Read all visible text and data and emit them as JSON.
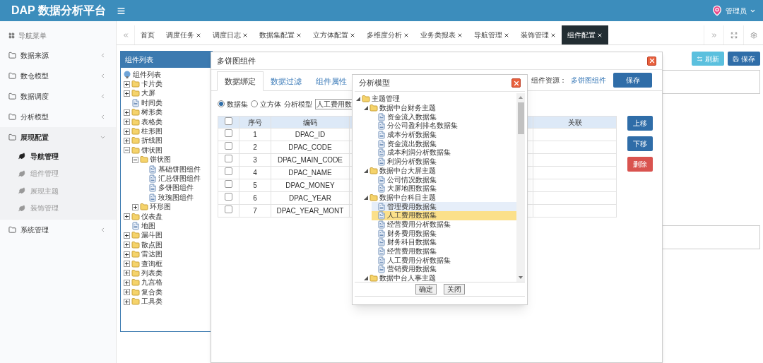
{
  "header": {
    "title": "DAP 数据分析平台",
    "user": "管理员"
  },
  "sidebar": {
    "title": "导航菜单",
    "items": [
      {
        "label": "数据来源",
        "expanded": false
      },
      {
        "label": "数仓模型",
        "expanded": false
      },
      {
        "label": "数据调度",
        "expanded": false
      },
      {
        "label": "分析模型",
        "expanded": false
      },
      {
        "label": "展现配置",
        "expanded": true,
        "children": [
          {
            "label": "导航管理",
            "selected": true
          },
          {
            "label": "组件管理",
            "selected": false
          },
          {
            "label": "展现主题",
            "selected": false
          },
          {
            "label": "装饰管理",
            "selected": false
          }
        ]
      },
      {
        "label": "系统管理",
        "expanded": false
      }
    ]
  },
  "tabs": [
    {
      "label": "首页",
      "closable": false,
      "selected": false
    },
    {
      "label": "调度任务",
      "closable": true,
      "selected": false
    },
    {
      "label": "调度日志",
      "closable": true,
      "selected": false
    },
    {
      "label": "数据集配置",
      "closable": true,
      "selected": false
    },
    {
      "label": "立方体配置",
      "closable": true,
      "selected": false
    },
    {
      "label": "多维度分析",
      "closable": true,
      "selected": false
    },
    {
      "label": "业务类报表",
      "closable": true,
      "selected": false
    },
    {
      "label": "导航管理",
      "closable": true,
      "selected": false
    },
    {
      "label": "装饰管理",
      "closable": true,
      "selected": false
    },
    {
      "label": "组件配置",
      "closable": true,
      "selected": true
    }
  ],
  "toolbar": [
    {
      "label": "刷新",
      "kind": "refresh"
    },
    {
      "label": "保存",
      "kind": "save"
    }
  ],
  "component_panel": {
    "title": "组件列表",
    "root": "组件列表",
    "tree": [
      {
        "label": "卡片类",
        "kind": "folder",
        "expanded": false
      },
      {
        "label": "大屏",
        "kind": "folder",
        "expanded": false
      },
      {
        "label": "时间类",
        "kind": "file"
      },
      {
        "label": "树形类",
        "kind": "folder",
        "expanded": false
      },
      {
        "label": "表格类",
        "kind": "folder",
        "expanded": false
      },
      {
        "label": "柱形图",
        "kind": "folder",
        "expanded": false
      },
      {
        "label": "折线图",
        "kind": "folder",
        "expanded": false
      },
      {
        "label": "饼状图",
        "kind": "folder",
        "expanded": true,
        "children": [
          {
            "label": "饼状图",
            "kind": "folder",
            "expanded": true,
            "children": [
              {
                "label": "基础饼图组件",
                "kind": "file"
              },
              {
                "label": "汇总饼图组件",
                "kind": "file"
              },
              {
                "label": "多饼图组件",
                "kind": "file"
              },
              {
                "label": "玫瑰图组件",
                "kind": "file"
              }
            ]
          },
          {
            "label": "环形图",
            "kind": "folder",
            "expanded": false
          }
        ]
      },
      {
        "label": "仪表盘",
        "kind": "folder",
        "expanded": false
      },
      {
        "label": "地图",
        "kind": "file"
      },
      {
        "label": "漏斗图",
        "kind": "folder",
        "expanded": false
      },
      {
        "label": "散点图",
        "kind": "folder",
        "expanded": false
      },
      {
        "label": "雷达图",
        "kind": "folder",
        "expanded": false
      },
      {
        "label": "查询框",
        "kind": "folder",
        "expanded": false
      },
      {
        "label": "列表类",
        "kind": "folder",
        "expanded": false
      },
      {
        "label": "九宫格",
        "kind": "folder",
        "expanded": false
      },
      {
        "label": "复合类",
        "kind": "folder",
        "expanded": false
      },
      {
        "label": "工具类",
        "kind": "folder",
        "expanded": false
      }
    ]
  },
  "dialog": {
    "title": "多饼图组件",
    "tabs": [
      {
        "label": "数据绑定",
        "selected": true
      },
      {
        "label": "数据过滤",
        "selected": false
      },
      {
        "label": "组件属性",
        "selected": false
      }
    ],
    "resource_label": "组件资源：",
    "resource_value": "多饼图组件",
    "save_label": "保存",
    "source_options": [
      {
        "label": "数据集",
        "selected": true
      },
      {
        "label": "立方体",
        "selected": false
      }
    ],
    "model_label": "分析模型",
    "model_value": "人工费用数",
    "table": {
      "header_checked": false,
      "columns": {
        "index": "序号",
        "code": "编码",
        "relation": "关联"
      },
      "rows": [
        {
          "checked": false,
          "index": "1",
          "code": "DPAC_ID"
        },
        {
          "checked": false,
          "index": "2",
          "code": "DPAC_CODE"
        },
        {
          "checked": false,
          "index": "3",
          "code": "DPAC_MAIN_CODE"
        },
        {
          "checked": false,
          "index": "4",
          "code": "DPAC_NAME"
        },
        {
          "checked": false,
          "index": "5",
          "code": "DPAC_MONEY"
        },
        {
          "checked": false,
          "index": "6",
          "code": "DPAC_YEAR"
        },
        {
          "checked": false,
          "index": "7",
          "code": "DPAC_YEAR_MONT"
        }
      ]
    },
    "side_buttons": [
      {
        "label": "上移",
        "kind": "primary"
      },
      {
        "label": "下移",
        "kind": "primary"
      },
      {
        "label": "删除",
        "kind": "danger"
      }
    ]
  },
  "picker": {
    "title": "分析模型",
    "tree": [
      {
        "label": "主题管理",
        "kind": "folder",
        "expanded": true,
        "children": [
          {
            "label": "数据中台财务主题",
            "kind": "folder",
            "expanded": true,
            "children": [
              {
                "label": "资金流入数据集",
                "kind": "file",
                "selected": false,
                "hovered": false
              },
              {
                "label": "分公司盈利排名数据集",
                "kind": "file",
                "selected": false,
                "hovered": false
              },
              {
                "label": "成本分析数据集",
                "kind": "file",
                "selected": false,
                "hovered": false
              },
              {
                "label": "资金流出数据集",
                "kind": "file",
                "selected": false,
                "hovered": false
              },
              {
                "label": "成本利润分析数据集",
                "kind": "file",
                "selected": false,
                "hovered": false
              },
              {
                "label": "利润分析数据集",
                "kind": "file",
                "selected": false,
                "hovered": false
              }
            ]
          },
          {
            "label": "数据中台大屏主题",
            "kind": "folder",
            "expanded": true,
            "children": [
              {
                "label": "公司情况数据集",
                "kind": "file",
                "selected": false,
                "hovered": false
              },
              {
                "label": "大屏地图数据集",
                "kind": "file",
                "selected": false,
                "hovered": false
              }
            ]
          },
          {
            "label": "数据中台科目主题",
            "kind": "folder",
            "expanded": true,
            "children": [
              {
                "label": "管理费用数据集",
                "kind": "file",
                "selected": false,
                "hovered": true
              },
              {
                "label": "人工费用数据集",
                "kind": "file",
                "selected": true,
                "hovered": false
              },
              {
                "label": "经营费用分析数据集",
                "kind": "file",
                "selected": false,
                "hovered": false
              },
              {
                "label": "财务费用数据集",
                "kind": "file",
                "selected": false,
                "hovered": false
              },
              {
                "label": "财务科目数据集",
                "kind": "file",
                "selected": false,
                "hovered": false
              },
              {
                "label": "经营费用数据集",
                "kind": "file",
                "selected": false,
                "hovered": false
              },
              {
                "label": "人工费用分析数据集",
                "kind": "file",
                "selected": false,
                "hovered": false
              },
              {
                "label": "营销费用数据集",
                "kind": "file",
                "selected": false,
                "hovered": false
              }
            ]
          },
          {
            "label": "数据中台人事主题",
            "kind": "folder",
            "expanded": true
          }
        ]
      }
    ],
    "buttons": [
      "确定",
      "关闭"
    ]
  }
}
